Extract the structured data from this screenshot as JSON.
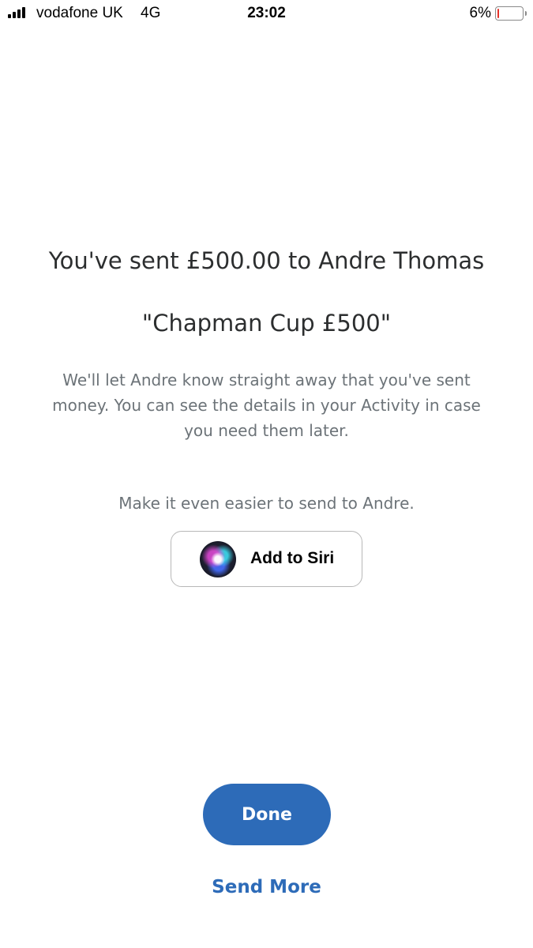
{
  "status_bar": {
    "carrier": "vodafone UK",
    "network": "4G",
    "time": "23:02",
    "battery_percent_label": "6%",
    "battery_level": 0.06,
    "battery_color": "#e5332a"
  },
  "confirmation": {
    "title": "You've sent £500.00 to Andre Thomas",
    "memo": "\"Chapman Cup £500\"",
    "description": "We'll let Andre know straight away that you've sent money. You can see the details in your Activity in case you need them later."
  },
  "siri": {
    "prompt": "Make it even easier to send to Andre.",
    "button_label": "Add to Siri",
    "icon": "siri-icon"
  },
  "actions": {
    "done_label": "Done",
    "send_more_label": "Send More",
    "accent_color": "#2d6bb8"
  }
}
